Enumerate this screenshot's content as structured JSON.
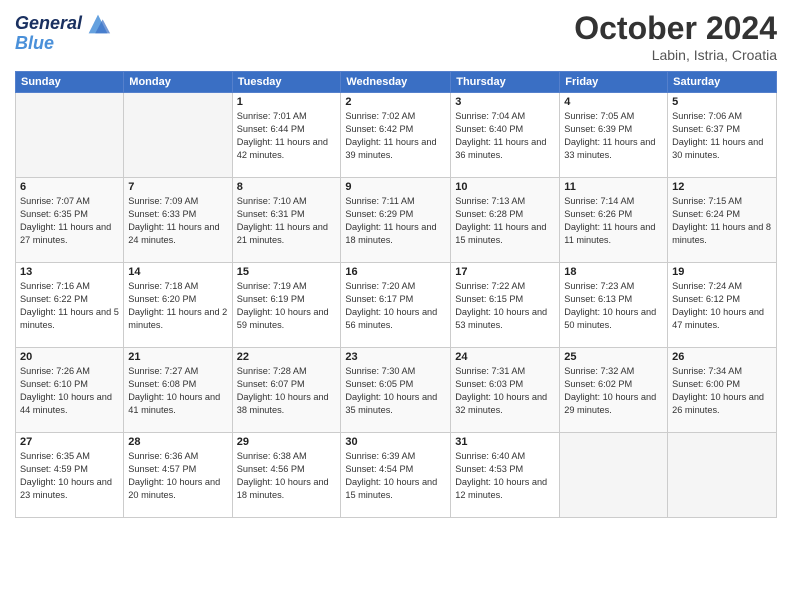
{
  "header": {
    "logo_line1": "General",
    "logo_line2": "Blue",
    "month": "October 2024",
    "location": "Labin, Istria, Croatia"
  },
  "days_of_week": [
    "Sunday",
    "Monday",
    "Tuesday",
    "Wednesday",
    "Thursday",
    "Friday",
    "Saturday"
  ],
  "weeks": [
    [
      {
        "day": "",
        "info": ""
      },
      {
        "day": "",
        "info": ""
      },
      {
        "day": "1",
        "info": "Sunrise: 7:01 AM\nSunset: 6:44 PM\nDaylight: 11 hours and 42 minutes."
      },
      {
        "day": "2",
        "info": "Sunrise: 7:02 AM\nSunset: 6:42 PM\nDaylight: 11 hours and 39 minutes."
      },
      {
        "day": "3",
        "info": "Sunrise: 7:04 AM\nSunset: 6:40 PM\nDaylight: 11 hours and 36 minutes."
      },
      {
        "day": "4",
        "info": "Sunrise: 7:05 AM\nSunset: 6:39 PM\nDaylight: 11 hours and 33 minutes."
      },
      {
        "day": "5",
        "info": "Sunrise: 7:06 AM\nSunset: 6:37 PM\nDaylight: 11 hours and 30 minutes."
      }
    ],
    [
      {
        "day": "6",
        "info": "Sunrise: 7:07 AM\nSunset: 6:35 PM\nDaylight: 11 hours and 27 minutes."
      },
      {
        "day": "7",
        "info": "Sunrise: 7:09 AM\nSunset: 6:33 PM\nDaylight: 11 hours and 24 minutes."
      },
      {
        "day": "8",
        "info": "Sunrise: 7:10 AM\nSunset: 6:31 PM\nDaylight: 11 hours and 21 minutes."
      },
      {
        "day": "9",
        "info": "Sunrise: 7:11 AM\nSunset: 6:29 PM\nDaylight: 11 hours and 18 minutes."
      },
      {
        "day": "10",
        "info": "Sunrise: 7:13 AM\nSunset: 6:28 PM\nDaylight: 11 hours and 15 minutes."
      },
      {
        "day": "11",
        "info": "Sunrise: 7:14 AM\nSunset: 6:26 PM\nDaylight: 11 hours and 11 minutes."
      },
      {
        "day": "12",
        "info": "Sunrise: 7:15 AM\nSunset: 6:24 PM\nDaylight: 11 hours and 8 minutes."
      }
    ],
    [
      {
        "day": "13",
        "info": "Sunrise: 7:16 AM\nSunset: 6:22 PM\nDaylight: 11 hours and 5 minutes."
      },
      {
        "day": "14",
        "info": "Sunrise: 7:18 AM\nSunset: 6:20 PM\nDaylight: 11 hours and 2 minutes."
      },
      {
        "day": "15",
        "info": "Sunrise: 7:19 AM\nSunset: 6:19 PM\nDaylight: 10 hours and 59 minutes."
      },
      {
        "day": "16",
        "info": "Sunrise: 7:20 AM\nSunset: 6:17 PM\nDaylight: 10 hours and 56 minutes."
      },
      {
        "day": "17",
        "info": "Sunrise: 7:22 AM\nSunset: 6:15 PM\nDaylight: 10 hours and 53 minutes."
      },
      {
        "day": "18",
        "info": "Sunrise: 7:23 AM\nSunset: 6:13 PM\nDaylight: 10 hours and 50 minutes."
      },
      {
        "day": "19",
        "info": "Sunrise: 7:24 AM\nSunset: 6:12 PM\nDaylight: 10 hours and 47 minutes."
      }
    ],
    [
      {
        "day": "20",
        "info": "Sunrise: 7:26 AM\nSunset: 6:10 PM\nDaylight: 10 hours and 44 minutes."
      },
      {
        "day": "21",
        "info": "Sunrise: 7:27 AM\nSunset: 6:08 PM\nDaylight: 10 hours and 41 minutes."
      },
      {
        "day": "22",
        "info": "Sunrise: 7:28 AM\nSunset: 6:07 PM\nDaylight: 10 hours and 38 minutes."
      },
      {
        "day": "23",
        "info": "Sunrise: 7:30 AM\nSunset: 6:05 PM\nDaylight: 10 hours and 35 minutes."
      },
      {
        "day": "24",
        "info": "Sunrise: 7:31 AM\nSunset: 6:03 PM\nDaylight: 10 hours and 32 minutes."
      },
      {
        "day": "25",
        "info": "Sunrise: 7:32 AM\nSunset: 6:02 PM\nDaylight: 10 hours and 29 minutes."
      },
      {
        "day": "26",
        "info": "Sunrise: 7:34 AM\nSunset: 6:00 PM\nDaylight: 10 hours and 26 minutes."
      }
    ],
    [
      {
        "day": "27",
        "info": "Sunrise: 6:35 AM\nSunset: 4:59 PM\nDaylight: 10 hours and 23 minutes."
      },
      {
        "day": "28",
        "info": "Sunrise: 6:36 AM\nSunset: 4:57 PM\nDaylight: 10 hours and 20 minutes."
      },
      {
        "day": "29",
        "info": "Sunrise: 6:38 AM\nSunset: 4:56 PM\nDaylight: 10 hours and 18 minutes."
      },
      {
        "day": "30",
        "info": "Sunrise: 6:39 AM\nSunset: 4:54 PM\nDaylight: 10 hours and 15 minutes."
      },
      {
        "day": "31",
        "info": "Sunrise: 6:40 AM\nSunset: 4:53 PM\nDaylight: 10 hours and 12 minutes."
      },
      {
        "day": "",
        "info": ""
      },
      {
        "day": "",
        "info": ""
      }
    ]
  ]
}
